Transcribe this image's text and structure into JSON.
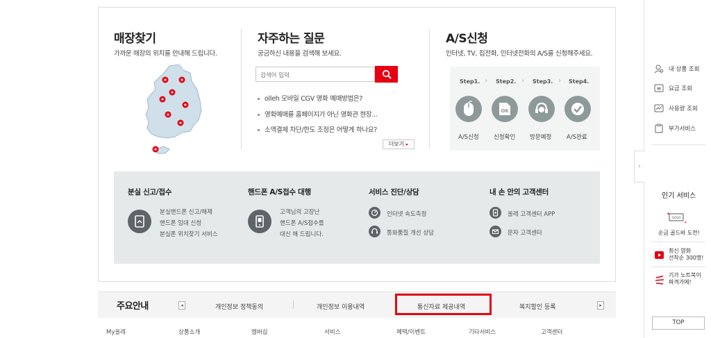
{
  "store": {
    "title": "매장찾기",
    "subtitle": "가까운 매장의 위치를 안내해 드립니다."
  },
  "faq": {
    "title": "자주하는 질문",
    "subtitle": "궁금하신 내용을 검색해 보세요.",
    "search_placeholder": "검색어 입력",
    "items": [
      "olleh 모바일 CGV 영화 예매방법은?",
      "영화예매를 홈페이지가 아닌 영화관 현장...",
      "소액결제 차단/한도 조정은 어떻게 하나요?"
    ],
    "more_label": "더보기",
    "more_arrow": "▸"
  },
  "as": {
    "title": "A/S신청",
    "subtitle": "인터넷, TV, 집전화, 인터넷전화의 A/S를 신청해주세요.",
    "steps": [
      {
        "step": "Step1.",
        "name": "A/S신청",
        "icon": "mouse-icon"
      },
      {
        "step": "Step2.",
        "name": "신청확인",
        "icon": "ok-icon"
      },
      {
        "step": "Step3.",
        "name": "방문예정",
        "icon": "headset-icon"
      },
      {
        "step": "Step4.",
        "name": "A/S완료",
        "icon": "check-icon"
      }
    ]
  },
  "band": {
    "lost": {
      "title": "분실 신고/접수",
      "lines": [
        "분실핸드폰 신고/해제",
        "핸드폰 임대 신청",
        "분실폰 위치찾기 서비스"
      ]
    },
    "phone_as": {
      "title": "핸드폰 A/S접수 대행",
      "lines": [
        "고객님의 고장난",
        "핸드폰 A/S접수를",
        "대신 해 드립니다."
      ]
    },
    "diagnosis": {
      "title": "서비스 진단/상담",
      "items": [
        "인터넷 속도측정",
        "통화품질 개선 상담"
      ]
    },
    "hand_center": {
      "title": "내 손 안의 고객센터",
      "items": [
        "올레 고객센터 APP",
        "문자 고객센터"
      ]
    }
  },
  "notice": {
    "title": "주요안내",
    "prev": "◂",
    "next": "▸",
    "items": [
      "개인정보 정책동의",
      "개인정보 이용내역",
      "통신자료 제공내역",
      "복지할인 등록"
    ]
  },
  "footer": {
    "items": [
      "My올레",
      "상품소개",
      "멤버십",
      "서비스",
      "혜택/이벤트",
      "기타서비스",
      "고객센터"
    ]
  },
  "sidebar": {
    "toggle": "›",
    "items": [
      {
        "label": "내 상품 조회",
        "icon": "user-search-icon"
      },
      {
        "label": "요금 조회",
        "icon": "bill-icon"
      },
      {
        "label": "사용량 조회",
        "icon": "usage-chart-icon"
      },
      {
        "label": "부가서비스",
        "icon": "clipboard-icon"
      }
    ],
    "popular_title": "인기 서비스",
    "popular": [
      {
        "label": "순금 골드바 도전!",
        "icon": "gold-bar-icon",
        "badge": "GOLD"
      },
      {
        "label": "최신 영화\n선착순 300명!",
        "icon": "play-icon"
      },
      {
        "label": "기가 노트북이\n파격가에!",
        "icon": "giga-icon"
      }
    ],
    "top_label": "TOP"
  },
  "colors": {
    "accent": "#e60012",
    "band": "#e5e9e9",
    "icon_dark": "#5d6568",
    "step_circle": "#8e9a9a",
    "map_fill": "#cfe0ea"
  }
}
